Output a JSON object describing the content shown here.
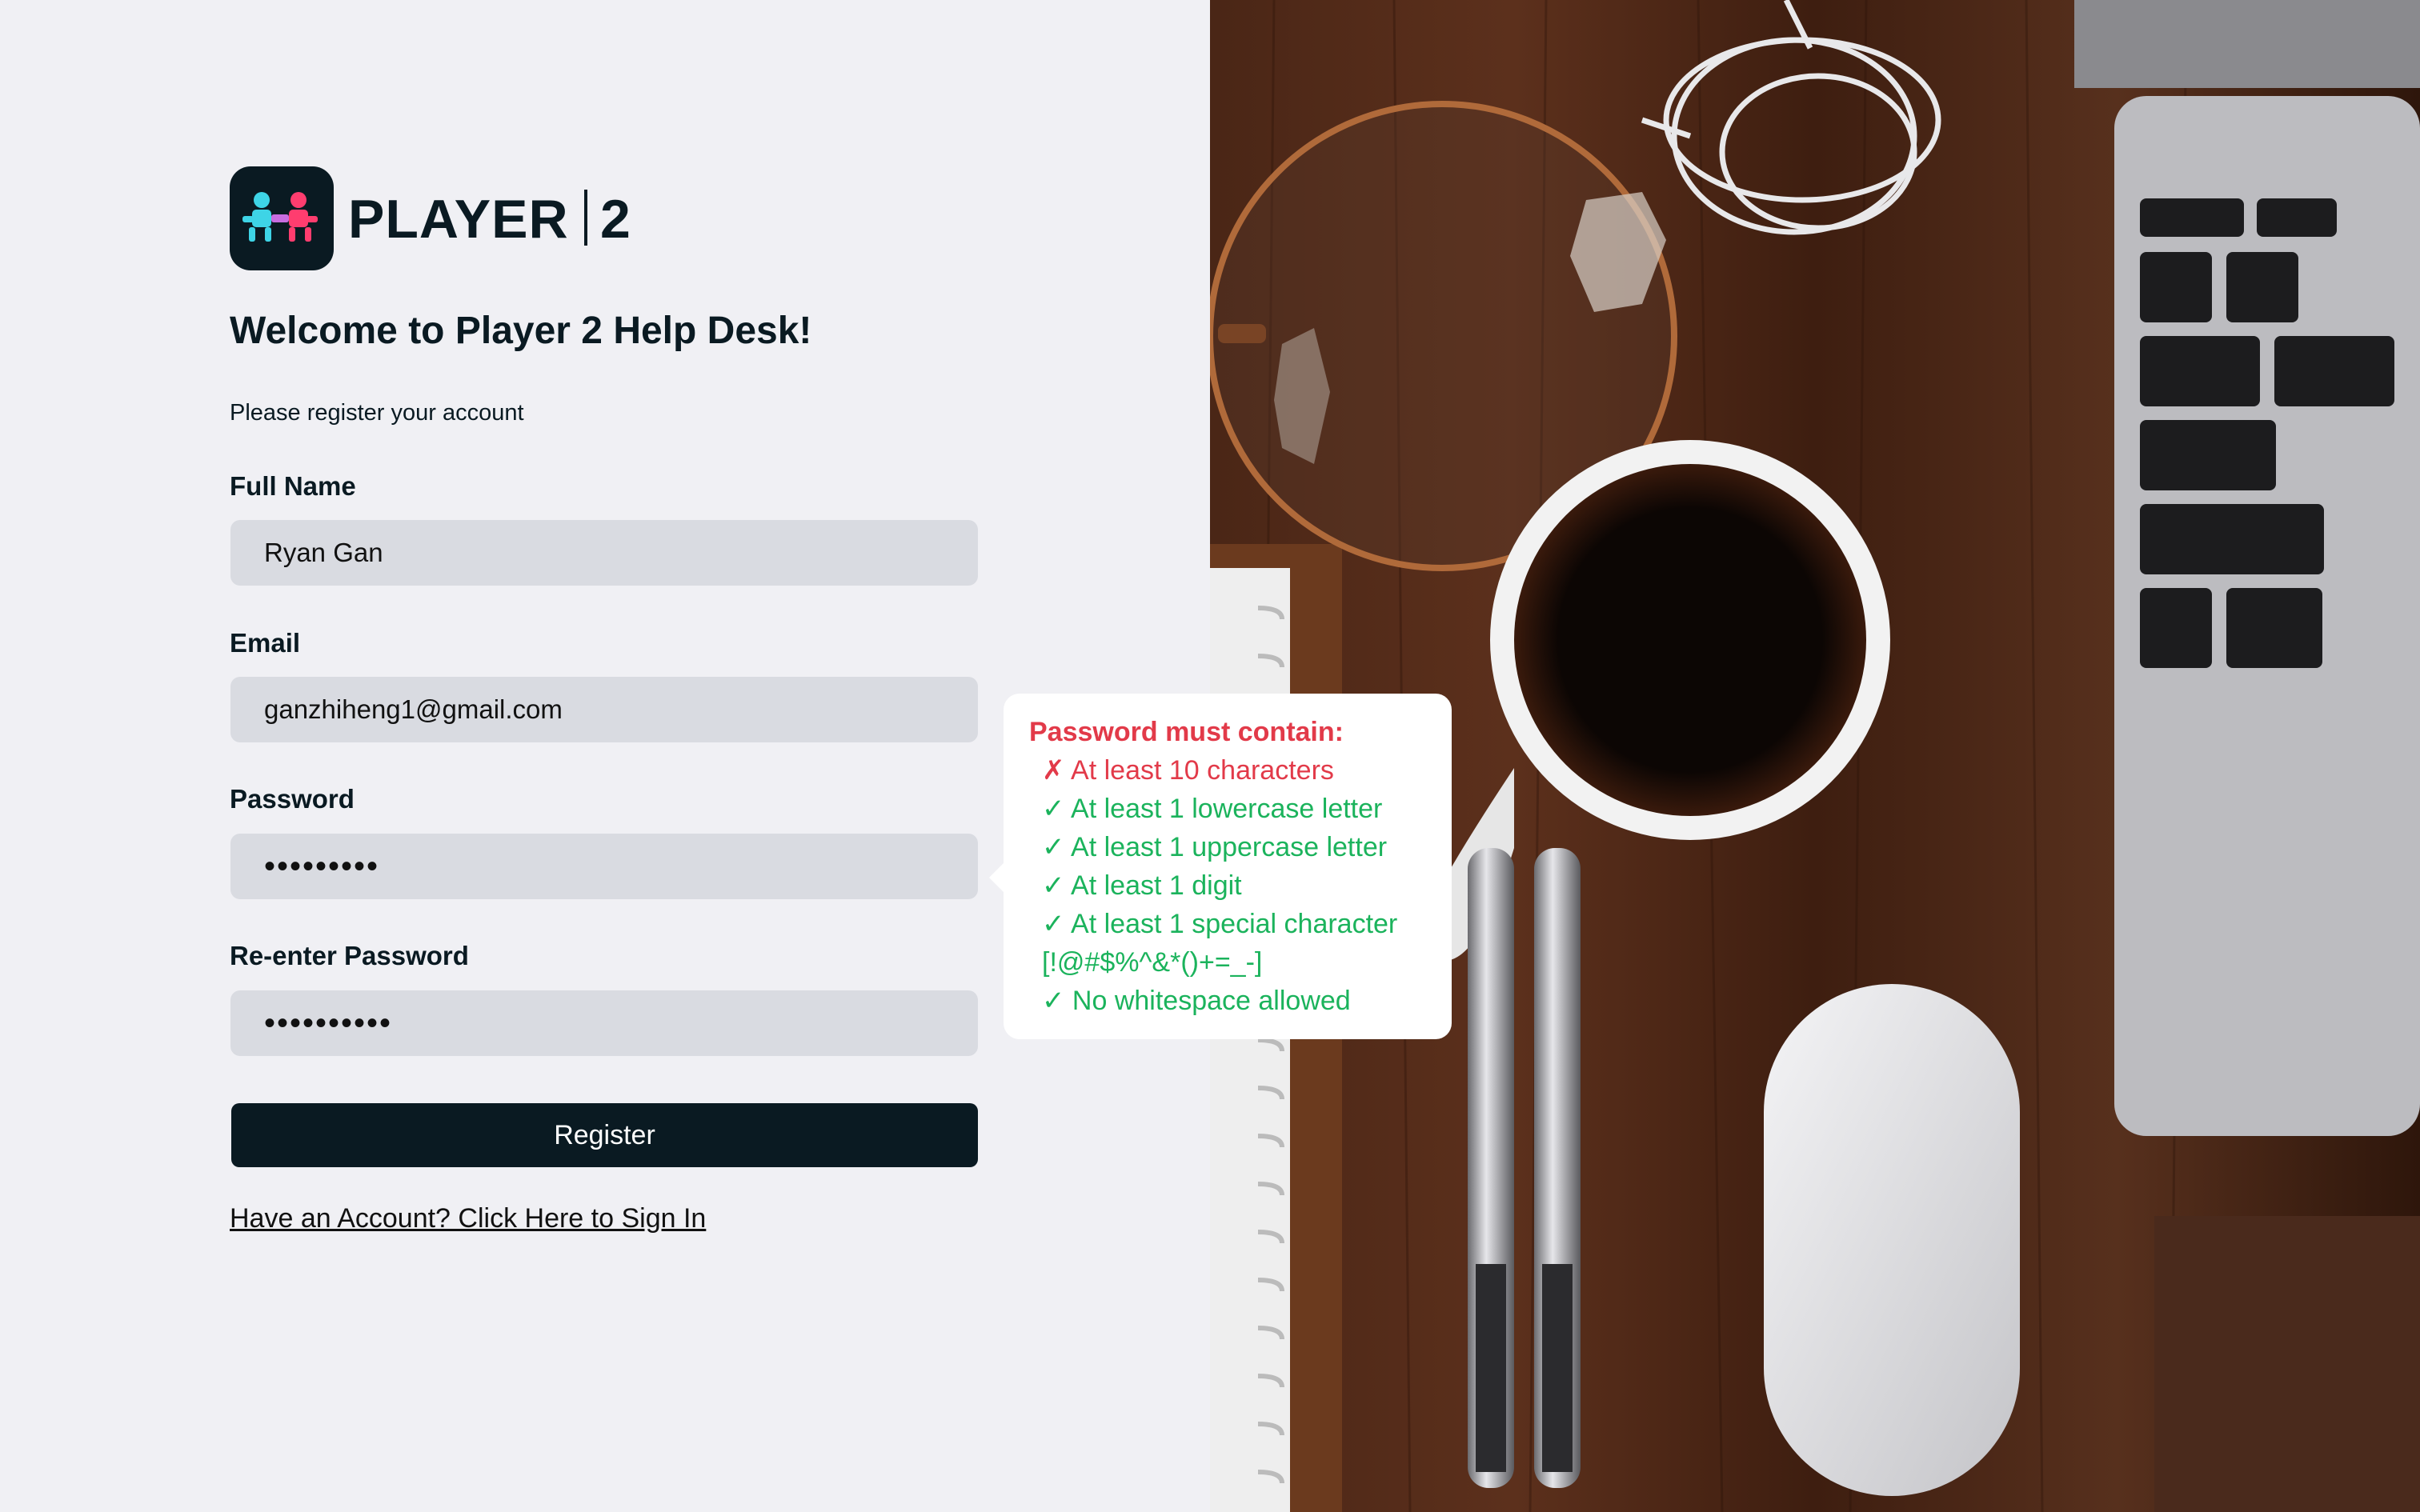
{
  "brand": {
    "name": "PLAYER",
    "number": "2"
  },
  "header": {
    "title": "Welcome to Player 2 Help Desk!",
    "subtitle": "Please register your account"
  },
  "form": {
    "full_name": {
      "label": "Full Name",
      "value": "Ryan Gan"
    },
    "email": {
      "label": "Email",
      "value": "ganzhiheng1@gmail.com"
    },
    "password": {
      "label": "Password",
      "value": "•••••••••"
    },
    "confirm_password": {
      "label": "Re-enter Password",
      "value": "••••••••••"
    },
    "register_label": "Register",
    "signin_link": "Have an Account? Click Here to Sign In"
  },
  "password_tooltip": {
    "title": "Password must contain:",
    "rules": [
      {
        "text": "✗ At least 10 characters",
        "status": "fail"
      },
      {
        "text": "✓ At least 1 lowercase letter",
        "status": "pass"
      },
      {
        "text": "✓ At least 1 uppercase letter",
        "status": "pass"
      },
      {
        "text": "✓ At least 1 digit",
        "status": "pass"
      },
      {
        "text": "✓ At least 1 special character",
        "status": "pass"
      },
      {
        "text": "[!@#$%^&*()+=_-]",
        "status": "pass"
      },
      {
        "text": "✓ No whitespace allowed",
        "status": "pass"
      }
    ]
  },
  "colors": {
    "brand_dark": "#0a1a22",
    "error": "#e23a49",
    "success": "#1bb35c",
    "input_bg": "#d9dbe1",
    "page_bg": "#f0f0f4"
  },
  "hero_image": {
    "alt": "",
    "icons": [
      "magnifying-glass-icon",
      "coffee-mug-icon",
      "pen-icon",
      "mouse-icon",
      "laptop-icon",
      "earphones-icon",
      "notebook-icon"
    ]
  }
}
